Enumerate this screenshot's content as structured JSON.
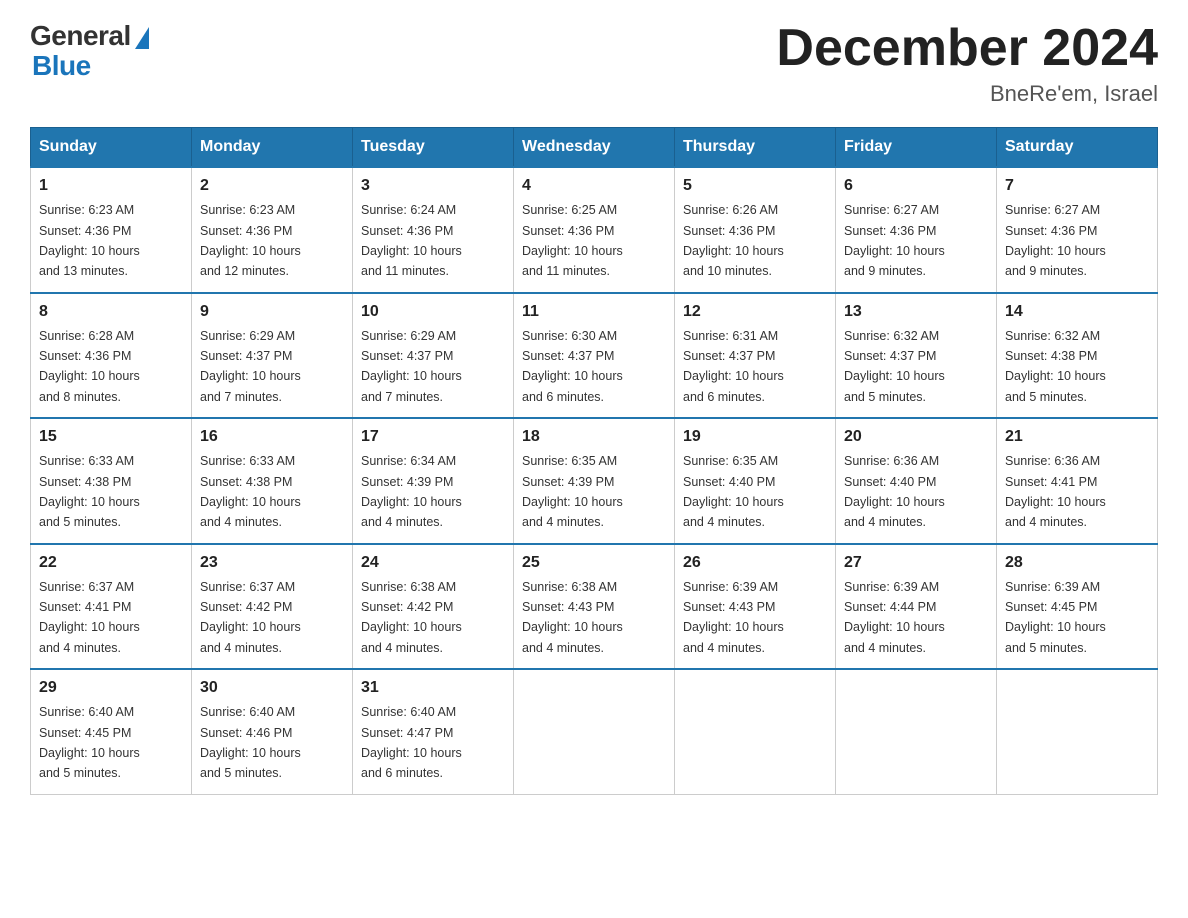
{
  "logo": {
    "general": "General",
    "blue": "Blue"
  },
  "title": "December 2024",
  "subtitle": "BneRe'em, Israel",
  "days_of_week": [
    "Sunday",
    "Monday",
    "Tuesday",
    "Wednesday",
    "Thursday",
    "Friday",
    "Saturday"
  ],
  "weeks": [
    [
      {
        "day": "1",
        "sunrise": "6:23 AM",
        "sunset": "4:36 PM",
        "daylight": "10 hours and 13 minutes."
      },
      {
        "day": "2",
        "sunrise": "6:23 AM",
        "sunset": "4:36 PM",
        "daylight": "10 hours and 12 minutes."
      },
      {
        "day": "3",
        "sunrise": "6:24 AM",
        "sunset": "4:36 PM",
        "daylight": "10 hours and 11 minutes."
      },
      {
        "day": "4",
        "sunrise": "6:25 AM",
        "sunset": "4:36 PM",
        "daylight": "10 hours and 11 minutes."
      },
      {
        "day": "5",
        "sunrise": "6:26 AM",
        "sunset": "4:36 PM",
        "daylight": "10 hours and 10 minutes."
      },
      {
        "day": "6",
        "sunrise": "6:27 AM",
        "sunset": "4:36 PM",
        "daylight": "10 hours and 9 minutes."
      },
      {
        "day": "7",
        "sunrise": "6:27 AM",
        "sunset": "4:36 PM",
        "daylight": "10 hours and 9 minutes."
      }
    ],
    [
      {
        "day": "8",
        "sunrise": "6:28 AM",
        "sunset": "4:36 PM",
        "daylight": "10 hours and 8 minutes."
      },
      {
        "day": "9",
        "sunrise": "6:29 AM",
        "sunset": "4:37 PM",
        "daylight": "10 hours and 7 minutes."
      },
      {
        "day": "10",
        "sunrise": "6:29 AM",
        "sunset": "4:37 PM",
        "daylight": "10 hours and 7 minutes."
      },
      {
        "day": "11",
        "sunrise": "6:30 AM",
        "sunset": "4:37 PM",
        "daylight": "10 hours and 6 minutes."
      },
      {
        "day": "12",
        "sunrise": "6:31 AM",
        "sunset": "4:37 PM",
        "daylight": "10 hours and 6 minutes."
      },
      {
        "day": "13",
        "sunrise": "6:32 AM",
        "sunset": "4:37 PM",
        "daylight": "10 hours and 5 minutes."
      },
      {
        "day": "14",
        "sunrise": "6:32 AM",
        "sunset": "4:38 PM",
        "daylight": "10 hours and 5 minutes."
      }
    ],
    [
      {
        "day": "15",
        "sunrise": "6:33 AM",
        "sunset": "4:38 PM",
        "daylight": "10 hours and 5 minutes."
      },
      {
        "day": "16",
        "sunrise": "6:33 AM",
        "sunset": "4:38 PM",
        "daylight": "10 hours and 4 minutes."
      },
      {
        "day": "17",
        "sunrise": "6:34 AM",
        "sunset": "4:39 PM",
        "daylight": "10 hours and 4 minutes."
      },
      {
        "day": "18",
        "sunrise": "6:35 AM",
        "sunset": "4:39 PM",
        "daylight": "10 hours and 4 minutes."
      },
      {
        "day": "19",
        "sunrise": "6:35 AM",
        "sunset": "4:40 PM",
        "daylight": "10 hours and 4 minutes."
      },
      {
        "day": "20",
        "sunrise": "6:36 AM",
        "sunset": "4:40 PM",
        "daylight": "10 hours and 4 minutes."
      },
      {
        "day": "21",
        "sunrise": "6:36 AM",
        "sunset": "4:41 PM",
        "daylight": "10 hours and 4 minutes."
      }
    ],
    [
      {
        "day": "22",
        "sunrise": "6:37 AM",
        "sunset": "4:41 PM",
        "daylight": "10 hours and 4 minutes."
      },
      {
        "day": "23",
        "sunrise": "6:37 AM",
        "sunset": "4:42 PM",
        "daylight": "10 hours and 4 minutes."
      },
      {
        "day": "24",
        "sunrise": "6:38 AM",
        "sunset": "4:42 PM",
        "daylight": "10 hours and 4 minutes."
      },
      {
        "day": "25",
        "sunrise": "6:38 AM",
        "sunset": "4:43 PM",
        "daylight": "10 hours and 4 minutes."
      },
      {
        "day": "26",
        "sunrise": "6:39 AM",
        "sunset": "4:43 PM",
        "daylight": "10 hours and 4 minutes."
      },
      {
        "day": "27",
        "sunrise": "6:39 AM",
        "sunset": "4:44 PM",
        "daylight": "10 hours and 4 minutes."
      },
      {
        "day": "28",
        "sunrise": "6:39 AM",
        "sunset": "4:45 PM",
        "daylight": "10 hours and 5 minutes."
      }
    ],
    [
      {
        "day": "29",
        "sunrise": "6:40 AM",
        "sunset": "4:45 PM",
        "daylight": "10 hours and 5 minutes."
      },
      {
        "day": "30",
        "sunrise": "6:40 AM",
        "sunset": "4:46 PM",
        "daylight": "10 hours and 5 minutes."
      },
      {
        "day": "31",
        "sunrise": "6:40 AM",
        "sunset": "4:47 PM",
        "daylight": "10 hours and 6 minutes."
      },
      null,
      null,
      null,
      null
    ]
  ],
  "labels": {
    "sunrise": "Sunrise:",
    "sunset": "Sunset:",
    "daylight": "Daylight:"
  }
}
